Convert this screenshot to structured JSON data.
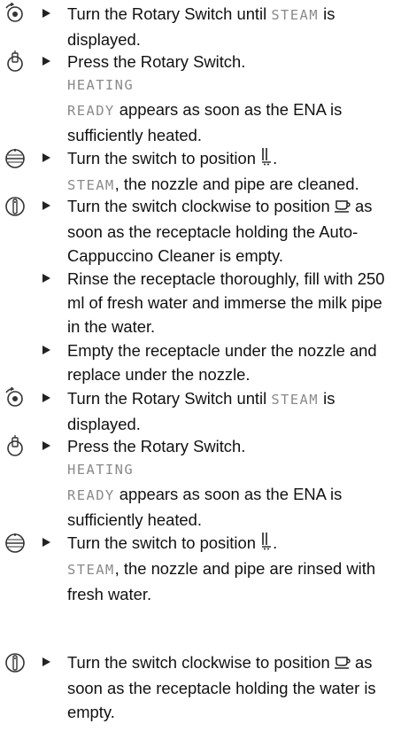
{
  "steps": [
    {
      "icon": "rotary-switch-icon",
      "parts": {
        "a": "Turn the Rotary Switch until ",
        "lcd": "STEAM",
        "b": " is displayed."
      }
    },
    {
      "icon": "press-switch-icon",
      "parts": {
        "a": "Press the Rotary Switch."
      },
      "lcd1": "HEATING",
      "lcd2": "READY",
      "after": " appears as soon as the ENA is sufficiently heated."
    },
    {
      "icon": "switch-position-icon",
      "parts": {
        "a": "Turn the switch to position "
      },
      "lcd": "STEAM",
      "after": ", the nozzle and pipe are cleaned."
    },
    {
      "icon": "power-switch-icon",
      "parts": {
        "a": "Turn the switch clockwise to position ",
        "b": " as soon as the receptacle holding the Auto-Cappuccino Cleaner is empty."
      }
    },
    {
      "parts": {
        "a": "Rinse the receptacle thoroughly, fill with 250 ml of fresh water and immerse the milk pipe in the water."
      }
    },
    {
      "parts": {
        "a": "Empty the receptacle under the nozzle and replace under the nozzle."
      }
    },
    {
      "icon": "rotary-switch-icon",
      "parts": {
        "a": "Turn the Rotary Switch until ",
        "lcd": "STEAM",
        "b": " is displayed."
      }
    },
    {
      "icon": "press-switch-icon",
      "parts": {
        "a": "Press the Rotary Switch."
      },
      "lcd1": "HEATING",
      "lcd2": "READY",
      "after": " appears as soon as the ENA is sufficiently heated."
    },
    {
      "icon": "switch-position-icon",
      "parts": {
        "a": "Turn the switch to position "
      },
      "lcd": "STEAM",
      "after": ", the nozzle and pipe are rinsed with fresh water."
    },
    {
      "icon": "power-switch-icon",
      "parts": {
        "a": "Turn the switch clockwise to position ",
        "b": " as soon as the receptacle holding the water is empty."
      }
    }
  ]
}
